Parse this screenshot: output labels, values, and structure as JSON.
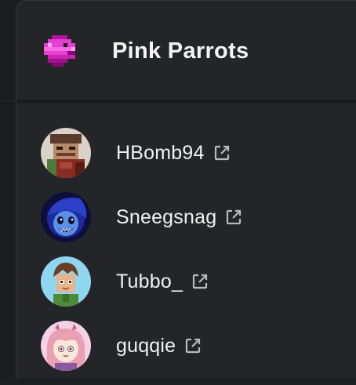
{
  "team": {
    "name": "Pink Parrots",
    "logo_icon": "pink-parrot-logo",
    "accent_color": "#e83fd3"
  },
  "members": [
    {
      "name": "HBomb94",
      "avatar_icon": "hbomb94-avatar",
      "link_icon": "external-link-icon"
    },
    {
      "name": "Sneegsnag",
      "avatar_icon": "sneegsnag-avatar",
      "link_icon": "external-link-icon"
    },
    {
      "name": "Tubbo_",
      "avatar_icon": "tubbo-avatar",
      "link_icon": "external-link-icon"
    },
    {
      "name": "guqqie",
      "avatar_icon": "guqqie-avatar",
      "link_icon": "external-link-icon"
    }
  ]
}
